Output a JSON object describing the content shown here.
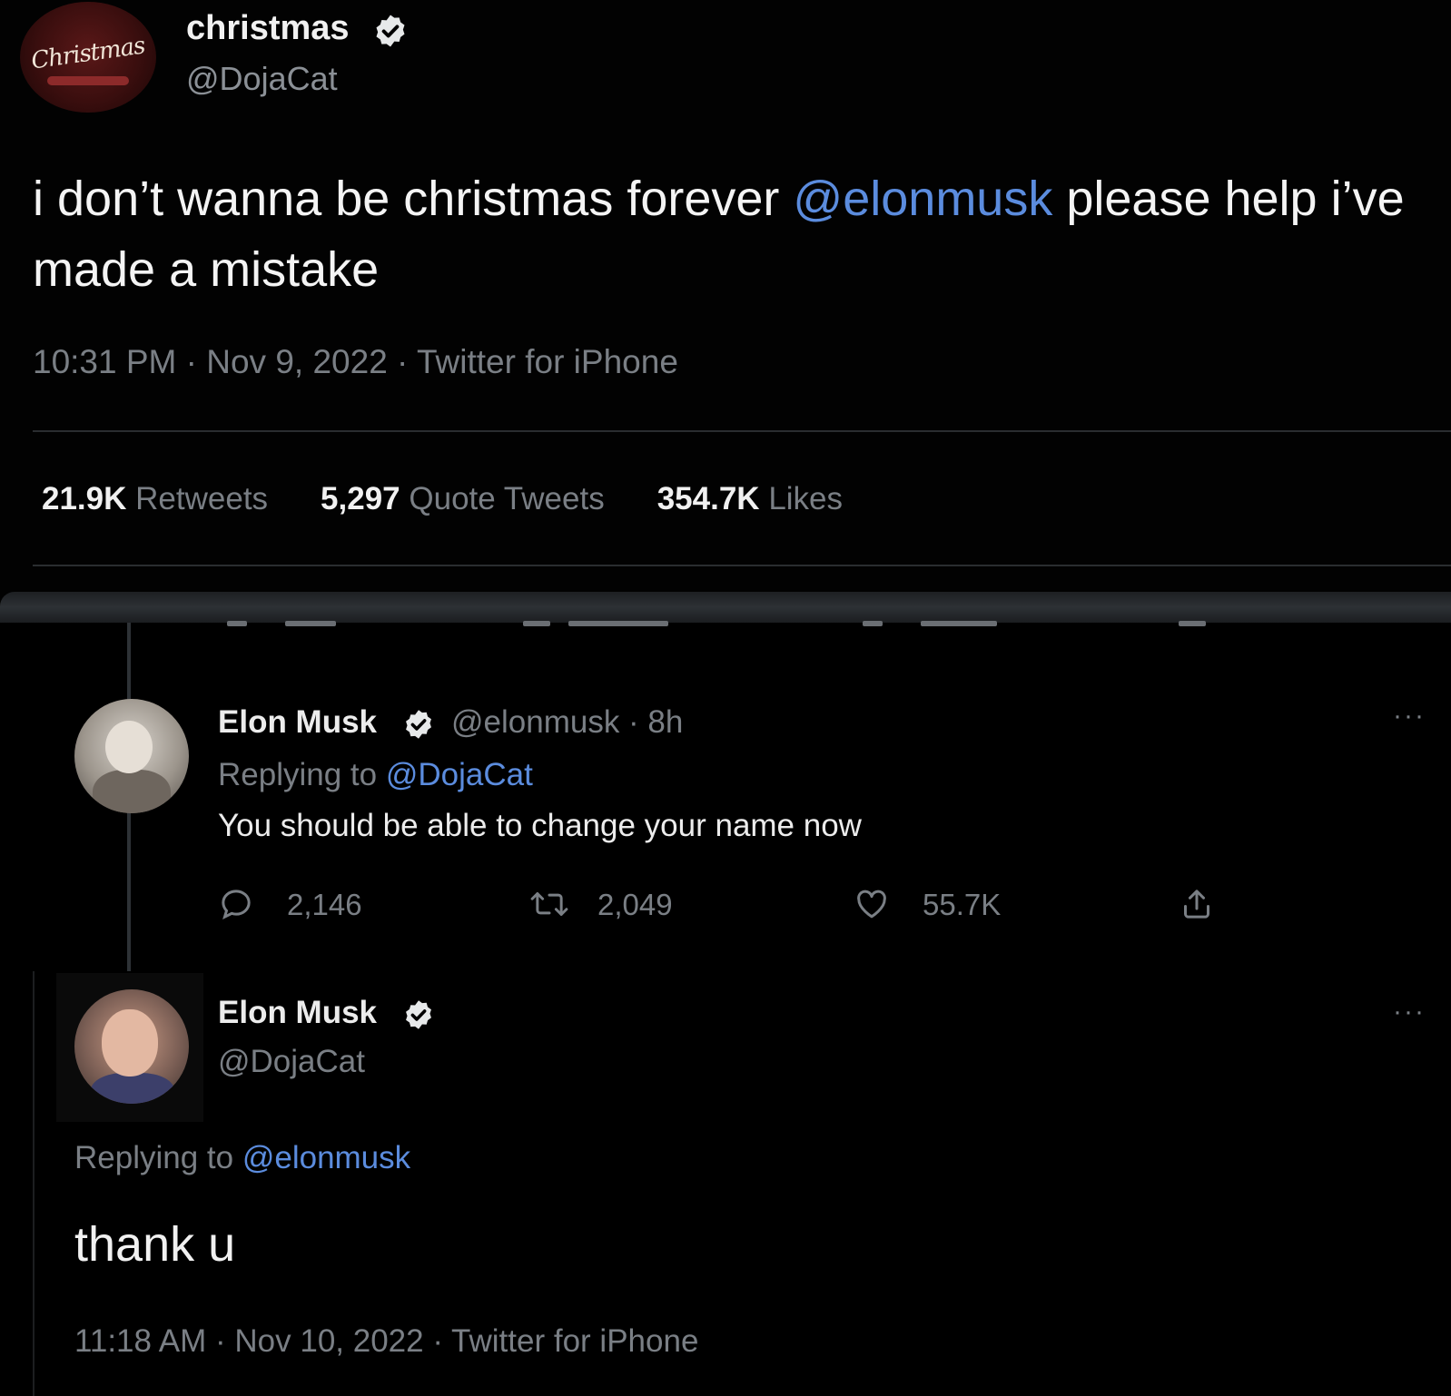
{
  "tweet": {
    "display_name": "christmas",
    "handle": "@DojaCat",
    "avatar_script": "Christmas",
    "text_before": "i don’t wanna be christmas forever ",
    "mention": "@elonmusk",
    "text_after": " please help i’ve made a mistake",
    "meta": "10:31 PM · Nov 9, 2022 · Twitter for iPhone",
    "stats": [
      {
        "value": "21.9K",
        "label": "Retweets"
      },
      {
        "value": "5,297",
        "label": "Quote Tweets"
      },
      {
        "value": "354.7K",
        "label": "Likes"
      }
    ]
  },
  "reply1": {
    "display_name": "Elon Musk",
    "handle_time": "@elonmusk · 8h",
    "replying_prefix": "Replying to ",
    "replying_handle": "@DojaCat",
    "text": "You should be able to change your name now",
    "more": "···",
    "actions": {
      "replies": "2,146",
      "retweets": "2,049",
      "likes": "55.7K"
    }
  },
  "reply2": {
    "display_name": "Elon Musk",
    "handle": "@DojaCat",
    "more": "···",
    "replying_prefix": "Replying to ",
    "replying_handle": "@elonmusk",
    "text": "thank u",
    "meta": "11:18 AM · Nov 10, 2022 · Twitter for iPhone"
  },
  "colors": {
    "background": "#000000",
    "mention": "#5b8cde",
    "muted": "#7a7f85",
    "verified": "#e7e9ea"
  }
}
